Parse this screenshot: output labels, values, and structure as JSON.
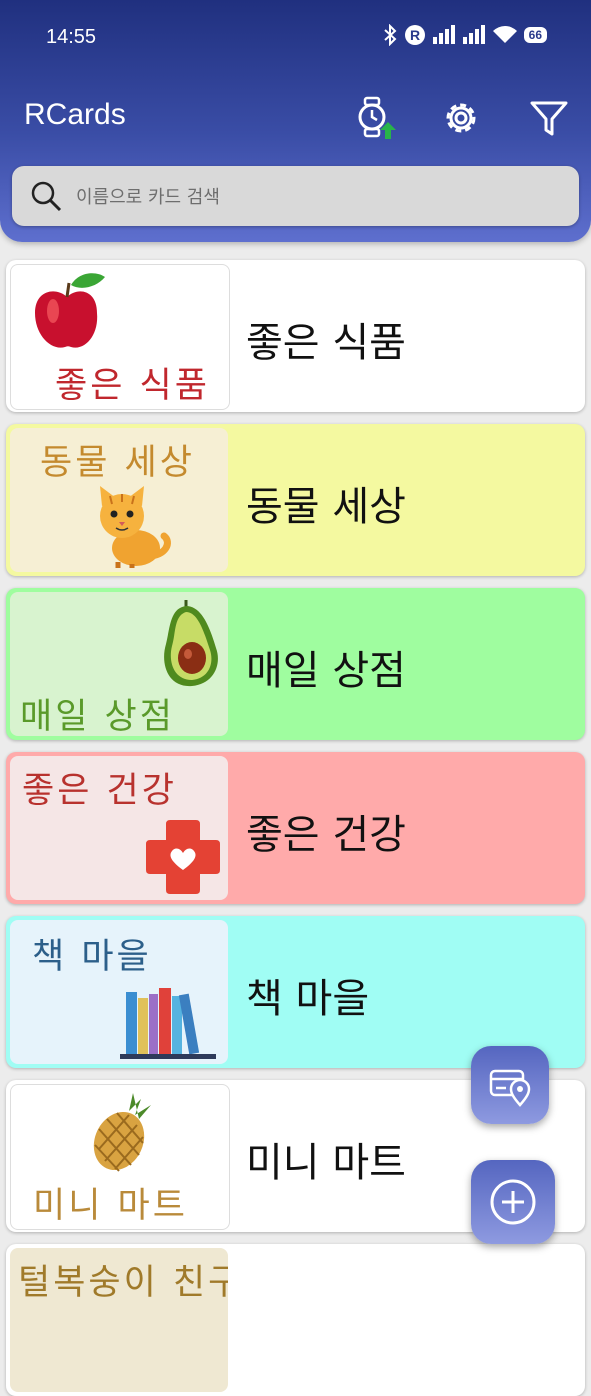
{
  "status": {
    "time": "14:55",
    "battery": "66"
  },
  "header": {
    "title": "RCards"
  },
  "search": {
    "placeholder": "이름으로 카드 검색"
  },
  "cards": [
    {
      "title": "좋은 식품",
      "thumb_text": "좋은 식품",
      "icon": "apple-icon",
      "bg": "#ffffff",
      "thumb_bg": "#ffffff",
      "thumb_color": "#c0272d"
    },
    {
      "title": "동물 세상",
      "thumb_text": "동물 세상",
      "icon": "cat-icon",
      "bg": "#f4f9a0",
      "thumb_bg": "#f6efd4",
      "thumb_color": "#c48a2e"
    },
    {
      "title": "매일 상점",
      "thumb_text": "매일 상점",
      "icon": "avocado-icon",
      "bg": "#9ffd9f",
      "thumb_bg": "#d8f3cf",
      "thumb_color": "#5a9a2a"
    },
    {
      "title": "좋은 건강",
      "thumb_text": "좋은 건강",
      "icon": "medical-cross-icon",
      "bg": "#ffaaaa",
      "thumb_bg": "#f5e6e6",
      "thumb_color": "#b8322e"
    },
    {
      "title": "책 마을",
      "thumb_text": "책 마을",
      "icon": "books-icon",
      "bg": "#a0fdf4",
      "thumb_bg": "#e6f3fb",
      "thumb_color": "#2c5f8a"
    },
    {
      "title": "미니 마트",
      "thumb_text": "미니 마트",
      "icon": "pineapple-icon",
      "bg": "#ffffff",
      "thumb_bg": "#ffffff",
      "thumb_color": "#b98a3a"
    },
    {
      "title": "",
      "thumb_text": "털복숭이 친구",
      "icon": "",
      "bg": "#ffffff",
      "thumb_bg": "#efe8d2",
      "thumb_color": "#a07a2a"
    }
  ]
}
